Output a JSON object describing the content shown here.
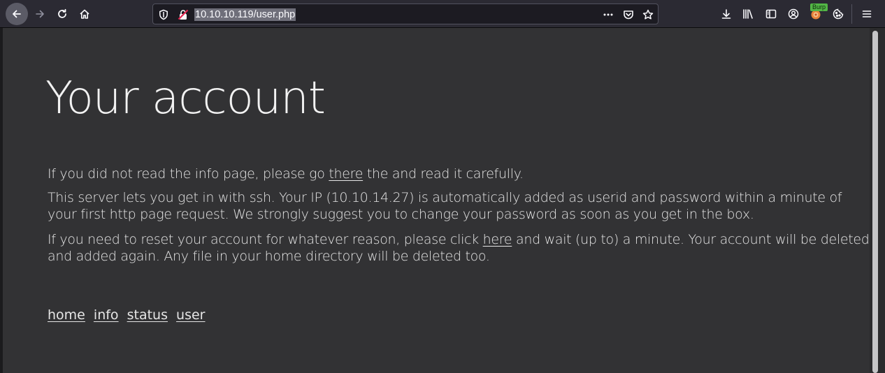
{
  "browser": {
    "url_text": "10.10.10.119/user.php",
    "burp_badge": "Burp",
    "icons": [
      "back-arrow-icon",
      "forward-arrow-icon",
      "reload-icon",
      "home-icon",
      "shield-icon",
      "insecure-lock-icon",
      "more-icon",
      "pocket-icon",
      "star-icon",
      "download-icon",
      "library-icon",
      "sidebar-icon",
      "account-icon",
      "burp-extension-icon",
      "cookie-icon",
      "menu-icon"
    ]
  },
  "page": {
    "title": "Your account",
    "p1": {
      "before": "If you did not read the info page, please go ",
      "link": "there",
      "after": " the and read it carefully."
    },
    "p2": "This server lets you get in with ssh. Your IP (10.10.14.27) is automatically added as userid and password within a minute of your first http page request. We strongly suggest you to change your password as soon as you get in the box.",
    "p3": {
      "before": "If you need to reset your account for whatever reason, please click ",
      "link": "here",
      "after": " and wait (up to) a minute. Your account will be deleted and added again. Any file in your home directory will be deleted too."
    },
    "nav": [
      "home",
      "info",
      "status",
      "user"
    ]
  },
  "colors": {
    "background": "#323234",
    "toolbar": "#2b2a33",
    "text": "#e6e6e6"
  }
}
